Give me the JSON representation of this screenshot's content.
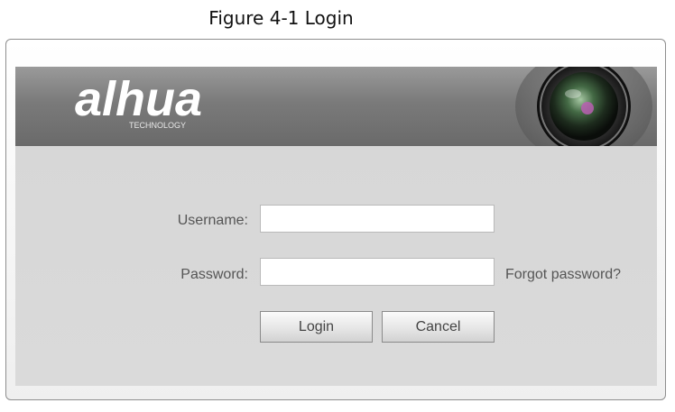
{
  "caption": "Figure 4-1 Login",
  "brand": {
    "logo_text": "alhua",
    "tagline": "TECHNOLOGY",
    "camera_icon": "camera-lens-icon"
  },
  "login_form": {
    "username_label": "Username:",
    "username_value": "",
    "password_label": "Password:",
    "password_value": "",
    "forgot_password_link": "Forgot password?",
    "login_button": "Login",
    "cancel_button": "Cancel"
  },
  "colors": {
    "banner": "#7a7a7a",
    "panel": "#d7d7d7",
    "label_text": "#555555"
  }
}
